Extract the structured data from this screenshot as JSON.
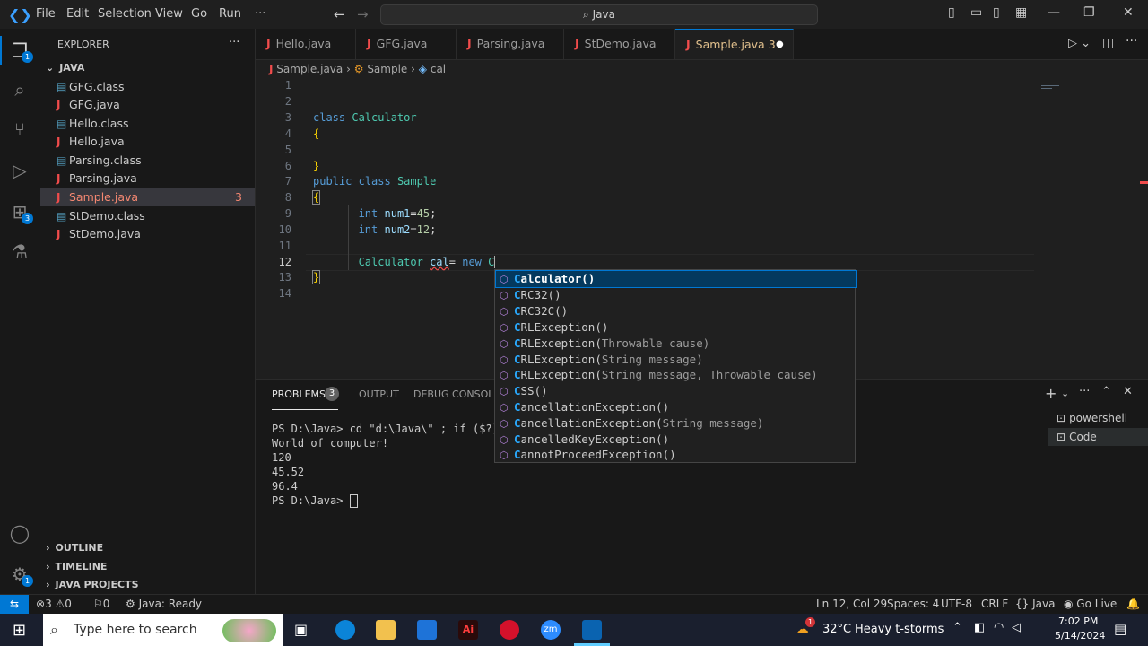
{
  "titlebar": {
    "menu": [
      "File",
      "Edit",
      "Selection",
      "View",
      "Go",
      "Run",
      "···"
    ],
    "search": "Java"
  },
  "activity": {
    "explorer_badge": "1",
    "extensions_badge": "3",
    "settings_badge": "1"
  },
  "sidebar": {
    "title": "EXPLORER",
    "folder": "JAVA",
    "files": [
      {
        "name": "GFG.class",
        "kind": "class"
      },
      {
        "name": "GFG.java",
        "kind": "java"
      },
      {
        "name": "Hello.class",
        "kind": "class"
      },
      {
        "name": "Hello.java",
        "kind": "java"
      },
      {
        "name": "Parsing.class",
        "kind": "class"
      },
      {
        "name": "Parsing.java",
        "kind": "java"
      },
      {
        "name": "Sample.java",
        "kind": "java",
        "problems": "3"
      },
      {
        "name": "StDemo.class",
        "kind": "class"
      },
      {
        "name": "StDemo.java",
        "kind": "java"
      }
    ],
    "sections": [
      "OUTLINE",
      "TIMELINE",
      "JAVA PROJECTS"
    ]
  },
  "tabs": [
    {
      "label": "Hello.java"
    },
    {
      "label": "GFG.java"
    },
    {
      "label": "Parsing.java"
    },
    {
      "label": "StDemo.java"
    },
    {
      "label": "Sample.java",
      "problems": "3"
    }
  ],
  "breadcrumb": {
    "file": "Sample.java",
    "cls": "Sample",
    "member": "cal"
  },
  "editor": {
    "line_numbers": [
      "1",
      "2",
      "3",
      "4",
      "5",
      "6",
      "7",
      "8",
      "9",
      "10",
      "11",
      "12",
      "13",
      "14"
    ],
    "current_line": "12"
  },
  "suggestions": [
    {
      "match": "C",
      "rest": "alculator()",
      "params": ""
    },
    {
      "match": "C",
      "rest": "RC32()",
      "params": ""
    },
    {
      "match": "C",
      "rest": "RC32C()",
      "params": ""
    },
    {
      "match": "C",
      "rest": "RLException()",
      "params": ""
    },
    {
      "match": "C",
      "rest": "RLException(",
      "params": "Throwable cause)"
    },
    {
      "match": "C",
      "rest": "RLException(",
      "params": "String message)"
    },
    {
      "match": "C",
      "rest": "RLException(",
      "params": "String message, Throwable cause)"
    },
    {
      "match": "C",
      "rest": "SS()",
      "params": ""
    },
    {
      "match": "C",
      "rest": "ancellationException()",
      "params": ""
    },
    {
      "match": "C",
      "rest": "ancellationException(",
      "params": "String message)"
    },
    {
      "match": "C",
      "rest": "ancelledKeyException()",
      "params": ""
    },
    {
      "match": "C",
      "rest": "annotProceedException()",
      "params": ""
    }
  ],
  "panel": {
    "tabs": [
      "PROBLEMS",
      "OUTPUT",
      "DEBUG CONSOLE"
    ],
    "problems_count": "3",
    "terminal_lines": [
      "PS D:\\Java> cd \"d:\\Java\\\" ; if ($?) {",
      "World of computer!",
      "120",
      "45.52",
      "96.4",
      "PS D:\\Java> "
    ],
    "terminals": [
      "powershell",
      "Code"
    ]
  },
  "status": {
    "errors": "3",
    "warnings": "0",
    "info": "0",
    "java": "Java: Ready",
    "position": "Ln 12, Col 29",
    "spaces": "Spaces: 4",
    "encoding": "UTF-8",
    "eol": "CRLF",
    "language": "Java",
    "golive": "Go Live"
  },
  "taskbar": {
    "search_placeholder": "Type here to search",
    "temperature": "32°C",
    "weather": "Heavy t-storms",
    "time": "7:02 PM",
    "date": "5/14/2024",
    "weather_badge": "1"
  },
  "colors": {
    "accent": "#0078d4",
    "java_icon": "#f14c4c",
    "modified_tab": "#e2c08d"
  }
}
